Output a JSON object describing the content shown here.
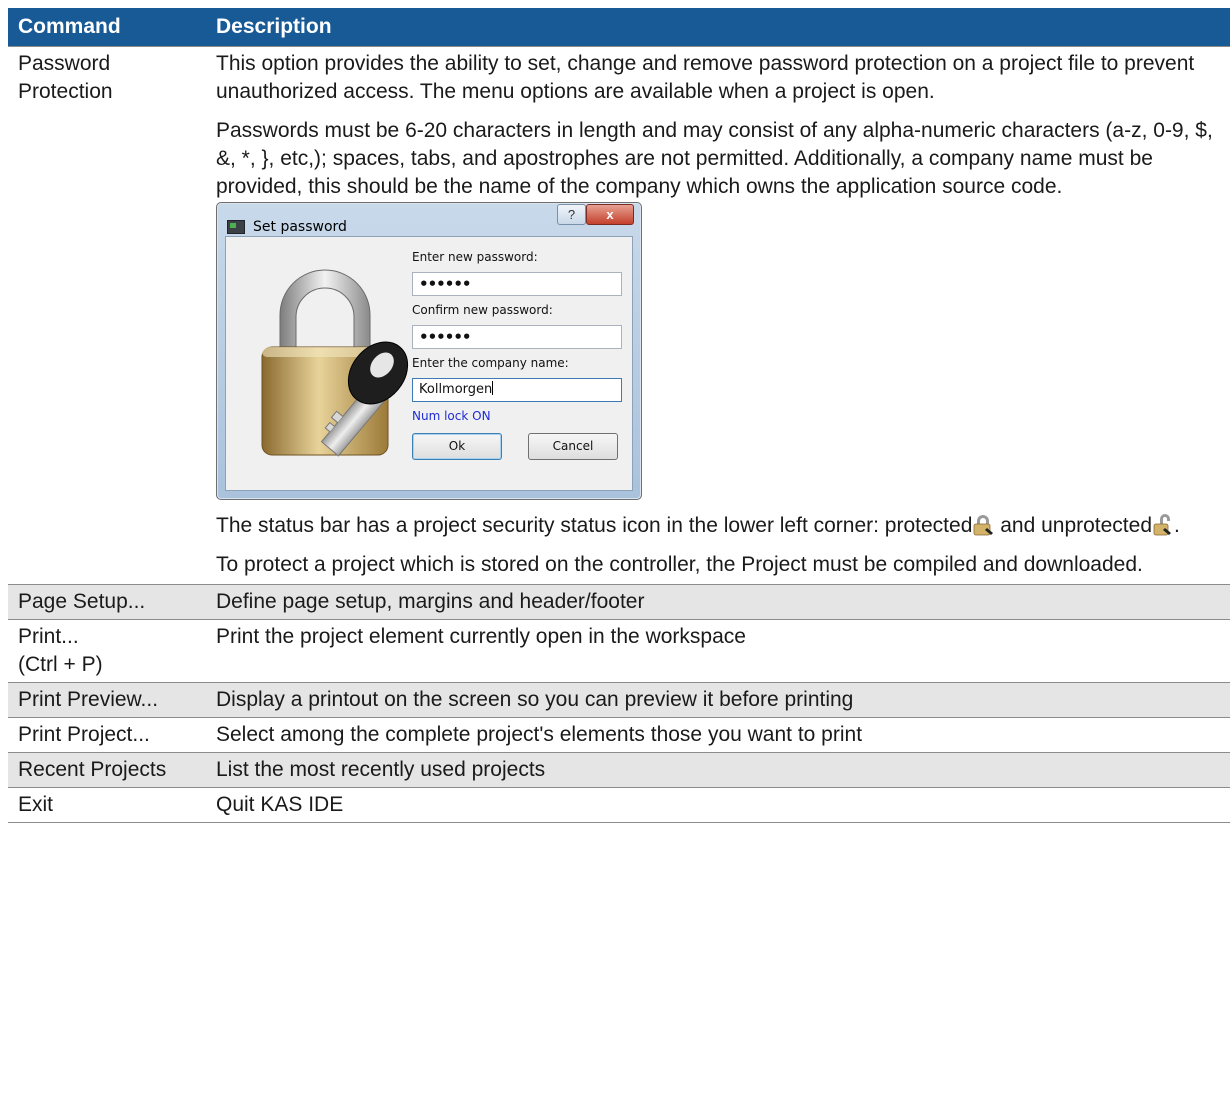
{
  "table": {
    "headers": {
      "command": "Command",
      "description": "Description"
    },
    "password_row": {
      "command": "Password Protection",
      "paragraphs": [
        "This option provides the ability to set, change and remove password protection on a project file to prevent unauthorized access. The menu options are available when a project is open.",
        "Passwords must be 6-20 characters in length and may consist of any alpha-numeric characters (a-z, 0-9, $, &, *, }, etc,); spaces, tabs, and apostrophes are not permitted. Additionally, a company name must be provided, this should be the name of the company which owns the application source code."
      ],
      "status_text_before": "The status bar has a project security status icon in the lower left corner: protected",
      "status_text_middle": " and unprotected",
      "status_text_end": ".",
      "last_paragraph": "To protect a project which is stored on the controller, the Project must be compiled and downloaded."
    },
    "rows": [
      {
        "command": "Page Setup...",
        "description": "Define page setup, margins and header/footer"
      },
      {
        "command": "Print...\n(Ctrl + P)",
        "description": "Print the project element currently open in the workspace"
      },
      {
        "command": "Print Preview...",
        "description": "Display a printout on the screen so you can preview it before printing"
      },
      {
        "command": "Print Project...",
        "description": "Select among the complete project's elements those you want to print"
      },
      {
        "command": "Recent Projects",
        "description": "List the most recently used projects"
      },
      {
        "command": "Exit",
        "description": "Quit KAS IDE"
      }
    ]
  },
  "dialog": {
    "title": "Set password",
    "help_button": "?",
    "close_button": "x",
    "new_password_label": "Enter new password:",
    "new_password_value": "••••••",
    "confirm_password_label": "Confirm new password:",
    "confirm_password_value": "••••••",
    "company_label": "Enter the company name:",
    "company_value": "Kollmorgen",
    "num_lock": "Num lock ON",
    "ok_button": "Ok",
    "cancel_button": "Cancel"
  },
  "colors": {
    "header_bg": "#185a96",
    "alt_row_bg": "#e5e5e5",
    "num_lock_text": "#1e2bd6"
  }
}
